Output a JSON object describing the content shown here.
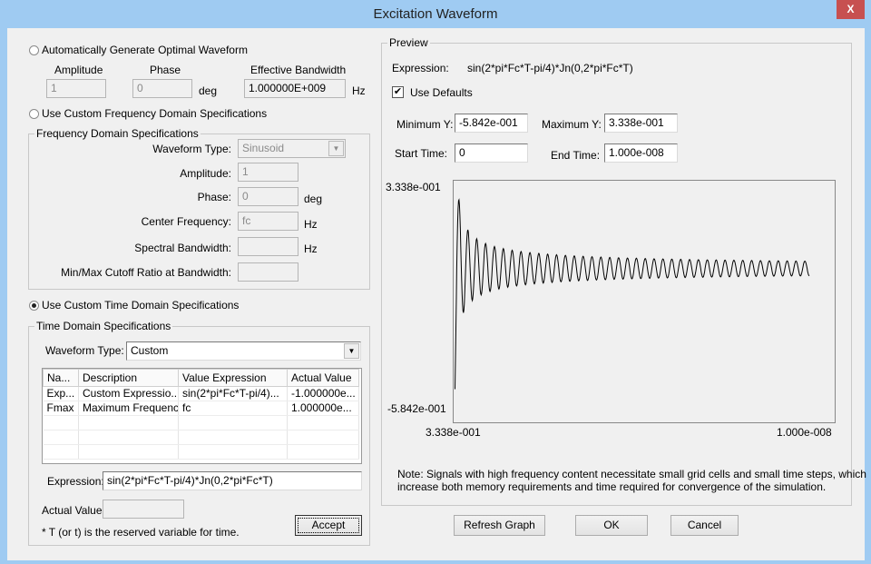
{
  "window": {
    "title": "Excitation Waveform",
    "close": "X"
  },
  "auto": {
    "label": "Automatically Generate Optimal Waveform",
    "selected": false,
    "amplitude_label": "Amplitude",
    "amplitude": "1",
    "phase_label": "Phase",
    "phase": "0",
    "deg": "deg",
    "bandwidth_label": "Effective Bandwidth",
    "bandwidth": "1.000000E+009",
    "hz": "Hz"
  },
  "freq": {
    "radio_label": "Use Custom Frequency Domain Specifications",
    "selected": false,
    "group_label": "Frequency Domain Specifications",
    "waveform_type_label": "Waveform Type:",
    "waveform_type": "Sinusoid",
    "amplitude_label": "Amplitude:",
    "amplitude": "1",
    "phase_label": "Phase:",
    "phase": "0",
    "deg": "deg",
    "center_label": "Center Frequency:",
    "center": "fc",
    "hz": "Hz",
    "spectral_label": "Spectral Bandwidth:",
    "spectral": "",
    "hz2": "Hz",
    "cutoff_label": "Min/Max Cutoff Ratio at Bandwidth:",
    "cutoff": ""
  },
  "time": {
    "radio_label": "Use Custom Time Domain Specifications",
    "selected": true,
    "group_label": "Time Domain Specifications",
    "waveform_type_label": "Waveform Type:",
    "waveform_type": "Custom",
    "columns": [
      "Na...",
      "Description",
      "Value Expression",
      "Actual Value"
    ],
    "rows": [
      [
        "Exp...",
        "Custom Expressio...",
        "sin(2*pi*Fc*T-pi/4)...",
        "-1.000000e..."
      ],
      [
        "Fmax",
        "Maximum Frequency",
        "fc",
        "1.000000e..."
      ]
    ],
    "expression_label": "Expression:",
    "expression": "sin(2*pi*Fc*T-pi/4)*Jn(0,2*pi*Fc*T)",
    "actual_label": "Actual Value:",
    "actual": "",
    "note": "* T (or t) is the reserved variable for time.",
    "accept": "Accept"
  },
  "preview": {
    "group_label": "Preview",
    "expression_label": "Expression:",
    "expression": "sin(2*pi*Fc*T-pi/4)*Jn(0,2*pi*Fc*T)",
    "use_defaults": "Use Defaults",
    "use_defaults_checked": true,
    "min_y_label": "Minimum Y:",
    "min_y": "-5.842e-001",
    "max_y_label": "Maximum Y:",
    "max_y": "3.338e-001",
    "start_label": "Start Time:",
    "start": "0",
    "end_label": "End Time:",
    "end": "1.000e-008",
    "note1": "Note: Signals with high frequency content necessitate small grid cells and small time steps, which",
    "note2": "increase both memory requirements and time required for convergence of the simulation."
  },
  "chart_data": {
    "type": "line",
    "expression": "sin(2*pi*Fc*T-pi/4)*Jn(0,2*pi*Fc*T)",
    "fc": 2000000000.0,
    "xlim": [
      0,
      1e-08
    ],
    "ylim": [
      -0.5842,
      0.3338
    ],
    "y_tick_labels": [
      "3.338e-001",
      "-5.842e-001"
    ],
    "x_tick_labels": [
      "3.338e-001",
      "1.000e-008"
    ]
  },
  "buttons": {
    "refresh": "Refresh Graph",
    "ok": "OK",
    "cancel": "Cancel"
  }
}
